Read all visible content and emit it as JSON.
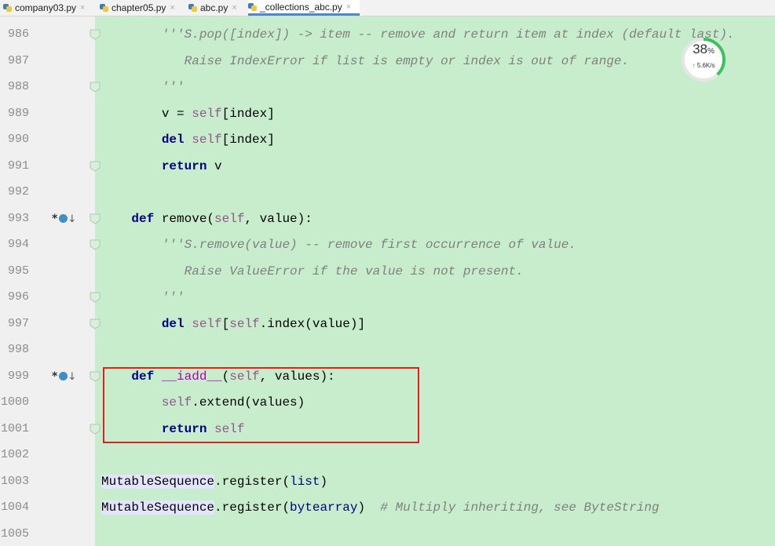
{
  "tabs": [
    {
      "label": "company03.py",
      "close": "×",
      "active": false
    },
    {
      "label": "chapter05.py",
      "close": "×",
      "active": false
    },
    {
      "label": "abc.py",
      "close": "×",
      "active": false
    },
    {
      "label": "_collections_abc.py",
      "close": "×",
      "active": true
    }
  ],
  "colors": {
    "editor_bg": "#c7edcc",
    "gutter_bg": "#f0f0f0",
    "keyword": "#000080",
    "self": "#94558d",
    "comment": "#808080",
    "highlight_box": "#e02020",
    "symbol_highlight": "#e4e4ff"
  },
  "lines": [
    {
      "num": "986",
      "indent": "        ",
      "tokens": [
        {
          "t": "'''S.pop([index]) -> item -- remove and return item at index (default last).",
          "c": "doc"
        }
      ]
    },
    {
      "num": "987",
      "indent": "           ",
      "tokens": [
        {
          "t": "Raise IndexError if list is empty or index is out of range.",
          "c": "doc"
        }
      ]
    },
    {
      "num": "988",
      "indent": "        ",
      "tokens": [
        {
          "t": "'''",
          "c": "doc"
        }
      ]
    },
    {
      "num": "989",
      "indent": "        ",
      "tokens": [
        {
          "t": "v = ",
          "c": ""
        },
        {
          "t": "self",
          "c": "slf"
        },
        {
          "t": "[index]",
          "c": ""
        }
      ]
    },
    {
      "num": "990",
      "indent": "        ",
      "tokens": [
        {
          "t": "del ",
          "c": "kw"
        },
        {
          "t": "self",
          "c": "slf"
        },
        {
          "t": "[index]",
          "c": ""
        }
      ]
    },
    {
      "num": "991",
      "indent": "        ",
      "tokens": [
        {
          "t": "return ",
          "c": "kw"
        },
        {
          "t": "v",
          "c": ""
        }
      ]
    },
    {
      "num": "992",
      "indent": "",
      "tokens": []
    },
    {
      "num": "993",
      "indent": "    ",
      "tokens": [
        {
          "t": "def ",
          "c": "kw"
        },
        {
          "t": "remove(",
          "c": ""
        },
        {
          "t": "self",
          "c": "slf"
        },
        {
          "t": ", value):",
          "c": ""
        }
      ]
    },
    {
      "num": "994",
      "indent": "        ",
      "tokens": [
        {
          "t": "'''S.remove(value) -- remove first occurrence of value.",
          "c": "doc"
        }
      ]
    },
    {
      "num": "995",
      "indent": "           ",
      "tokens": [
        {
          "t": "Raise ValueError if the value is not present.",
          "c": "doc"
        }
      ]
    },
    {
      "num": "996",
      "indent": "        ",
      "tokens": [
        {
          "t": "'''",
          "c": "doc"
        }
      ]
    },
    {
      "num": "997",
      "indent": "        ",
      "tokens": [
        {
          "t": "del ",
          "c": "kw"
        },
        {
          "t": "self",
          "c": "slf"
        },
        {
          "t": "[",
          "c": ""
        },
        {
          "t": "self",
          "c": "slf"
        },
        {
          "t": ".index(value)]",
          "c": ""
        }
      ]
    },
    {
      "num": "998",
      "indent": "",
      "tokens": []
    },
    {
      "num": "999",
      "indent": "    ",
      "tokens": [
        {
          "t": "def ",
          "c": "kw"
        },
        {
          "t": "__iadd__",
          "c": "mag"
        },
        {
          "t": "(",
          "c": ""
        },
        {
          "t": "self",
          "c": "slf"
        },
        {
          "t": ", values):",
          "c": ""
        }
      ]
    },
    {
      "num": "1000",
      "indent": "        ",
      "tokens": [
        {
          "t": "self",
          "c": "slf"
        },
        {
          "t": ".extend(values)",
          "c": ""
        }
      ]
    },
    {
      "num": "1001",
      "indent": "        ",
      "tokens": [
        {
          "t": "return ",
          "c": "kw"
        },
        {
          "t": "self",
          "c": "slf"
        }
      ]
    },
    {
      "num": "1002",
      "indent": "",
      "tokens": []
    },
    {
      "num": "1003",
      "indent": "",
      "tokens": [
        {
          "t": "MutableSequence",
          "c": "hl"
        },
        {
          "t": ".register(",
          "c": ""
        },
        {
          "t": "list",
          "c": "blt"
        },
        {
          "t": ")",
          "c": ""
        }
      ]
    },
    {
      "num": "1004",
      "indent": "",
      "tokens": [
        {
          "t": "MutableSequence",
          "c": "hl"
        },
        {
          "t": ".register(",
          "c": ""
        },
        {
          "t": "bytearray",
          "c": "blt"
        },
        {
          "t": ")  ",
          "c": ""
        },
        {
          "t": "# Multiply inheriting, see ByteString",
          "c": "cmt"
        }
      ]
    },
    {
      "num": "1005",
      "indent": "",
      "tokens": []
    }
  ],
  "gutter_markers": [
    {
      "line": "993",
      "symbol": "*",
      "icon": "override-icon",
      "arrow": "↓"
    },
    {
      "line": "999",
      "symbol": "*",
      "icon": "override-icon",
      "arrow": "↓"
    }
  ],
  "fold_lines": [
    "986",
    "988",
    "991",
    "993",
    "994",
    "996",
    "997",
    "999",
    "1001"
  ],
  "network_widget": {
    "percent": "38",
    "percent_unit": "%",
    "speed_arrow": "↑",
    "speed": "5.6K/s",
    "level": 0.38
  }
}
